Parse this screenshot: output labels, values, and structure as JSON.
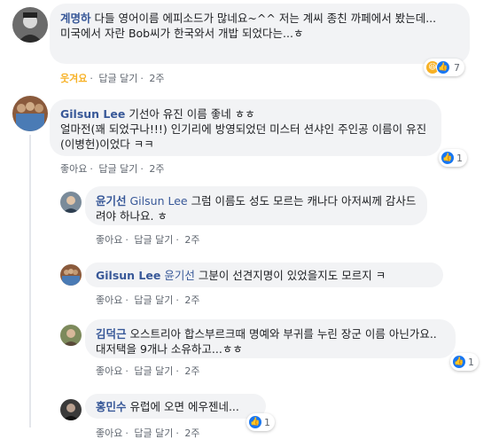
{
  "comments": [
    {
      "author": "계명하",
      "text": "다들 영어이름 에피소드가 많네요~^^ 저는 계씨 종친 까페에서 봤는데...",
      "text2": "미국에서 자란 Bob씨가 한국와서 개밥 되었다는...ㅎ",
      "like_label": "웃겨요",
      "reply_label": "답글 달기",
      "time": "2주",
      "reaction_count": "7"
    },
    {
      "author": "Gilsun Lee",
      "text": "기선아 유진 이름 좋네 ㅎㅎ",
      "text2": "얼마전(꽤 되었구나!!!) 인기리에 방영되었던 미스터 션샤인 주인공 이름이 유진 (이병헌)이었다 ㅋㅋ",
      "like_label": "좋아요",
      "reply_label": "답글 달기",
      "time": "2주",
      "reaction_count": "1"
    }
  ],
  "replies": [
    {
      "author": "윤기선",
      "ref": "Gilsun Lee",
      "text": "그럼 이름도 성도 모르는 캐나다 아저씨께 감사드려야 하나요. ㅎ",
      "like_label": "좋아요",
      "reply_label": "답글 달기",
      "time": "2주"
    },
    {
      "author": "Gilsun Lee",
      "ref": "윤기선",
      "text": "그분이 선견지명이 있었을지도 모르지 ㅋ",
      "like_label": "좋아요",
      "reply_label": "답글 달기",
      "time": "2주"
    },
    {
      "author": "김덕근",
      "ref": "",
      "text": "오스트리아 합스부르크때 명예와 부귀를 누린 장군 이름 아닌가요.. 대저택을 9개나 소유하고...ㅎㅎ",
      "like_label": "좋아요",
      "reply_label": "답글 달기",
      "time": "2주",
      "reaction_count": "1"
    },
    {
      "author": "홍민수",
      "ref": "",
      "text": "유럽에 오면 에우젠네...",
      "like_label": "좋아요",
      "reply_label": "답글 달기",
      "time": "2주",
      "reaction_count": "1"
    }
  ],
  "icons": {
    "haha": "😆",
    "like": "👍"
  },
  "colors": {
    "author": "#385898",
    "bubble": "#f2f3f5",
    "like_blue": "#1877f2",
    "haha_yellow": "#f7b125"
  }
}
